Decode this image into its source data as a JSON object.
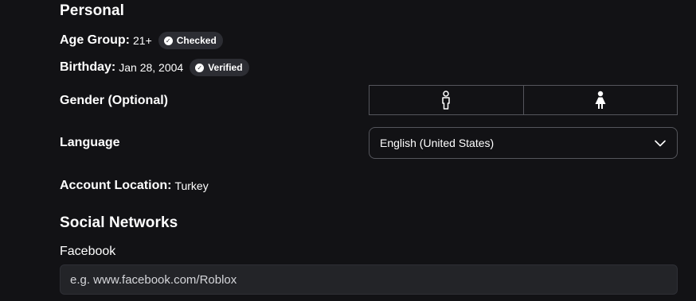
{
  "personal": {
    "title": "Personal",
    "age_group": {
      "label": "Age Group:",
      "value": "21+",
      "badge": "Checked"
    },
    "birthday": {
      "label": "Birthday:",
      "value": "Jan 28, 2004",
      "badge": "Verified"
    },
    "gender": {
      "label": "Gender (Optional)",
      "options": [
        {
          "icon": "male-person-icon",
          "selected": false
        },
        {
          "icon": "female-person-icon",
          "selected": true
        }
      ]
    },
    "language": {
      "label": "Language",
      "selected": "English (United States)",
      "icon": "chevron-down-icon"
    },
    "account_location": {
      "label": "Account Location:",
      "value": "Turkey"
    }
  },
  "social": {
    "title": "Social Networks",
    "facebook": {
      "label": "Facebook",
      "placeholder": "e.g. www.facebook.com/Roblox",
      "value": ""
    }
  },
  "colors": {
    "background": "#121215",
    "badge_bg": "#2c2d33",
    "border": "#55565c",
    "input_bg": "#232428"
  }
}
